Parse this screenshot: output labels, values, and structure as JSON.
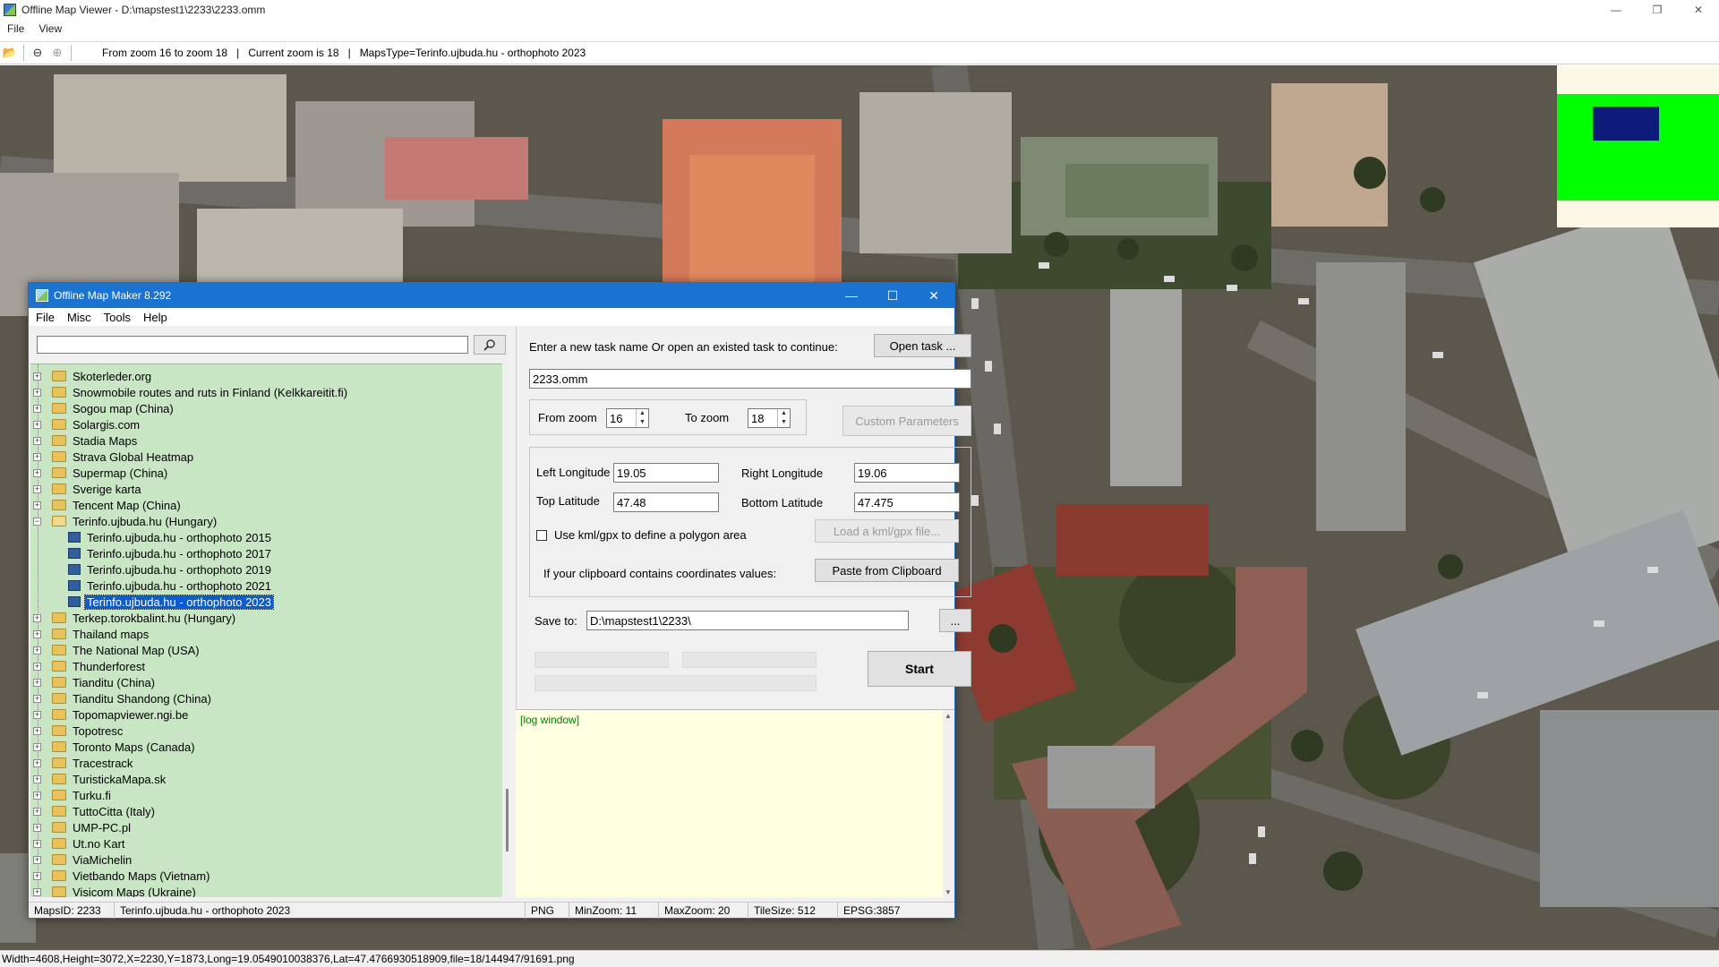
{
  "viewer": {
    "title": "Offline Map Viewer - D:\\mapstest1\\2233\\2233.omm",
    "menu": [
      "File",
      "View"
    ],
    "toolbar": {
      "zoom_range": "From zoom 16 to zoom 18",
      "sep1": "|",
      "current_zoom": "Current zoom is 18",
      "sep2": "|",
      "maps_type": "MapsType=Terinfo.ujbuda.hu - orthophoto 2023"
    },
    "status": "Width=4608,Height=3072,X=2230,Y=1873,Long=19.0549010038376,Lat=47.4766930518909,file=18/144947/91691.png"
  },
  "maker": {
    "title": "Offline Map Maker 8.292",
    "menu": [
      "File",
      "Misc",
      "Tools",
      "Help"
    ],
    "search": {
      "value": "",
      "placeholder": ""
    },
    "tree": [
      {
        "label": "Skoterleder.org",
        "kind": "folder"
      },
      {
        "label": "Snowmobile routes and ruts in Finland (Kelkkareitit.fi)",
        "kind": "folder"
      },
      {
        "label": "Sogou map (China)",
        "kind": "folder"
      },
      {
        "label": "Solargis.com",
        "kind": "folder"
      },
      {
        "label": "Stadia Maps",
        "kind": "folder"
      },
      {
        "label": "Strava Global Heatmap",
        "kind": "folder"
      },
      {
        "label": "Supermap (China)",
        "kind": "folder"
      },
      {
        "label": "Sverige karta",
        "kind": "folder"
      },
      {
        "label": "Tencent Map (China)",
        "kind": "folder"
      },
      {
        "label": "Terinfo.ujbuda.hu (Hungary)",
        "kind": "folder-open"
      },
      {
        "label": "Terinfo.ujbuda.hu - orthophoto 2015",
        "kind": "leaf"
      },
      {
        "label": "Terinfo.ujbuda.hu - orthophoto 2017",
        "kind": "leaf"
      },
      {
        "label": "Terinfo.ujbuda.hu - orthophoto 2019",
        "kind": "leaf"
      },
      {
        "label": "Terinfo.ujbuda.hu - orthophoto 2021",
        "kind": "leaf"
      },
      {
        "label": "Terinfo.ujbuda.hu - orthophoto 2023",
        "kind": "leaf-selected"
      },
      {
        "label": "Terkep.torokbalint.hu (Hungary)",
        "kind": "folder"
      },
      {
        "label": "Thailand maps",
        "kind": "folder"
      },
      {
        "label": "The National Map (USA)",
        "kind": "folder"
      },
      {
        "label": "Thunderforest",
        "kind": "folder"
      },
      {
        "label": "Tianditu (China)",
        "kind": "folder"
      },
      {
        "label": "Tianditu Shandong (China)",
        "kind": "folder"
      },
      {
        "label": "Topomapviewer.ngi.be",
        "kind": "folder"
      },
      {
        "label": "Topotresc",
        "kind": "folder"
      },
      {
        "label": "Toronto Maps (Canada)",
        "kind": "folder"
      },
      {
        "label": "Tracestrack",
        "kind": "folder"
      },
      {
        "label": "TuristickaMapa.sk",
        "kind": "folder"
      },
      {
        "label": "Turku.fi",
        "kind": "folder"
      },
      {
        "label": "TuttoCitta (Italy)",
        "kind": "folder"
      },
      {
        "label": "UMP-PC.pl",
        "kind": "folder"
      },
      {
        "label": "Ut.no Kart",
        "kind": "folder"
      },
      {
        "label": "ViaMichelin",
        "kind": "folder"
      },
      {
        "label": "Vietbando Maps (Vietnam)",
        "kind": "folder"
      },
      {
        "label": "Visicom Maps (Ukraine)",
        "kind": "folder"
      }
    ],
    "task": {
      "prompt": "Enter a new task name Or open an existed task to continue:",
      "open_label": "Open task ...",
      "name_value": "2233.omm"
    },
    "zoom": {
      "from_label": "From zoom",
      "from_value": "16",
      "to_label": "To zoom",
      "to_value": "18",
      "custom_label": "Custom Parameters"
    },
    "coords": {
      "left_lon_label": "Left Longitude",
      "left_lon_value": "19.05",
      "right_lon_label": "Right Longitude",
      "right_lon_value": "19.06",
      "top_lat_label": "Top Latitude",
      "top_lat_value": "47.48",
      "bottom_lat_label": "Bottom Latitude",
      "bottom_lat_value": "47.475",
      "kml_check_label": "Use kml/gpx to define a polygon area",
      "kml_checked": false,
      "load_kml_label": "Load a kml/gpx file...",
      "clipboard_prompt": "If your clipboard contains coordinates values:",
      "paste_label": "Paste from Clipboard"
    },
    "save": {
      "label": "Save to:",
      "path_value": "D:\\mapstest1\\2233\\",
      "browse_label": "..."
    },
    "progress": {
      "bar1": 0,
      "bar2": 0,
      "bar3": 0
    },
    "start_label": "Start",
    "log_text": "[log window]",
    "status": {
      "maps_id": "MapsID: 2233",
      "maps_name": "Terinfo.ujbuda.hu - orthophoto 2023",
      "format": "PNG",
      "min_zoom": "MinZoom: 11",
      "max_zoom": "MaxZoom: 20",
      "tile_size": "TileSize: 512",
      "epsg": "EPSG:3857"
    }
  },
  "colors": {
    "title_blue": "#1a73d1",
    "tree_bg": "#c8e6c4",
    "selection": "#0a5bd7",
    "log_bg": "#ffffe1",
    "log_text": "#008000",
    "minimap_green": "#00ff00",
    "minimap_blue": "#0d1a7a"
  }
}
